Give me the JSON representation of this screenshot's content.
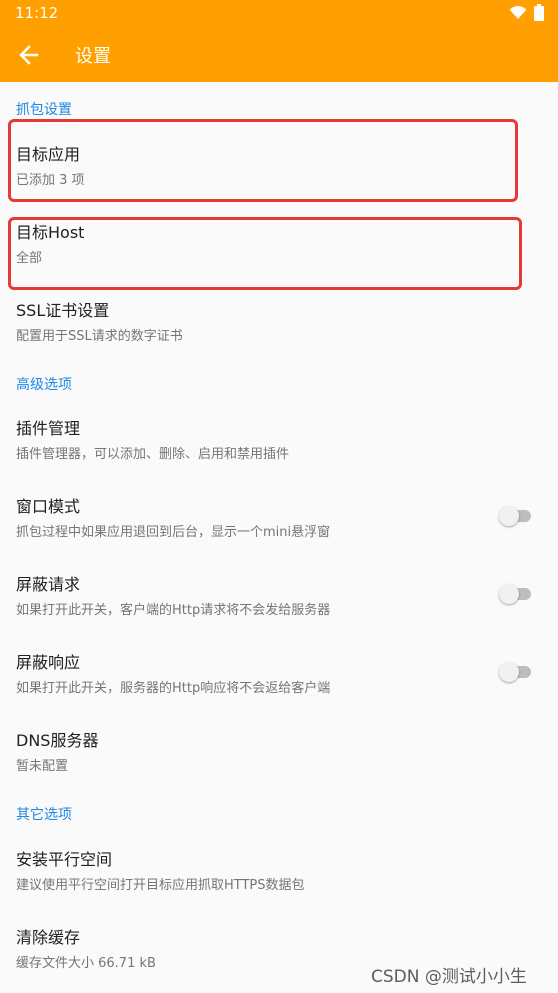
{
  "status_bar": {
    "time": "11:12",
    "wifi_icon": "wifi-icon",
    "battery_icon": "battery-icon"
  },
  "app_bar": {
    "title": "设置",
    "back_icon": "arrow-left-icon",
    "color": "#ffa000"
  },
  "sections": {
    "capture": {
      "header": "抓包设置"
    },
    "advanced": {
      "header": "高级选项"
    },
    "other": {
      "header": "其它选项"
    }
  },
  "items": {
    "target_app": {
      "title": "目标应用",
      "summary": "已添加 3 项"
    },
    "target_host": {
      "title": "目标Host",
      "summary": "全部"
    },
    "ssl": {
      "title": "SSL证书设置",
      "summary": "配置用于SSL请求的数字证书"
    },
    "plugins": {
      "title": "插件管理",
      "summary": "插件管理器，可以添加、删除、启用和禁用插件"
    },
    "window_mode": {
      "title": "窗口模式",
      "summary": "抓包过程中如果应用退回到后台，显示一个mini悬浮窗",
      "switch_on": false
    },
    "block_request": {
      "title": "屏蔽请求",
      "summary": "如果打开此开关，客户端的Http请求将不会发给服务器",
      "switch_on": false
    },
    "block_response": {
      "title": "屏蔽响应",
      "summary": "如果打开此开关，服务器的Http响应将不会返给客户端",
      "switch_on": false
    },
    "dns": {
      "title": "DNS服务器",
      "summary": "暂未配置"
    },
    "parallel_space": {
      "title": "安装平行空间",
      "summary": "建议使用平行空间打开目标应用抓取HTTPS数据包"
    },
    "clear_cache": {
      "title": "清除缓存",
      "summary": "缓存文件大小 66.71 kB"
    }
  },
  "watermark": "CSDN @测试小小生",
  "colors": {
    "section_header": "#1e88e5",
    "highlight": "#e53935"
  }
}
